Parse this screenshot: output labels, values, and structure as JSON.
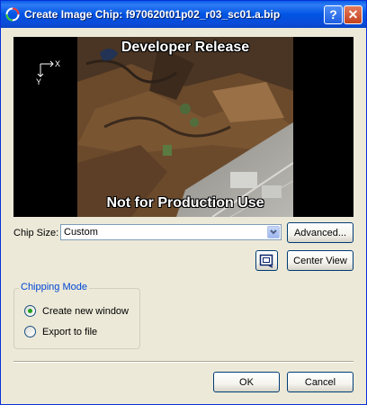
{
  "window": {
    "title": "Create Image Chip: f970620t01p02_r03_sc01.a.bip",
    "help_label": "?",
    "close_label": "✕"
  },
  "preview": {
    "axis_x_label": "X",
    "axis_y_label": "Y",
    "overlay_top": "Developer Release",
    "overlay_bottom": "Not for Production Use"
  },
  "chip_size": {
    "label": "Chip Size:",
    "value": "Custom"
  },
  "buttons": {
    "advanced": "Advanced...",
    "center_view": "Center View",
    "ok": "OK",
    "cancel": "Cancel"
  },
  "chipping_mode": {
    "title": "Chipping Mode",
    "options": [
      {
        "label": "Create new window",
        "selected": true
      },
      {
        "label": "Export to file",
        "selected": false
      }
    ]
  },
  "colors": {
    "titlebar": "#0054E3",
    "dialog_bg": "#ECE9D8",
    "group_title": "#0046D5",
    "radio_selected": "#21A121"
  }
}
